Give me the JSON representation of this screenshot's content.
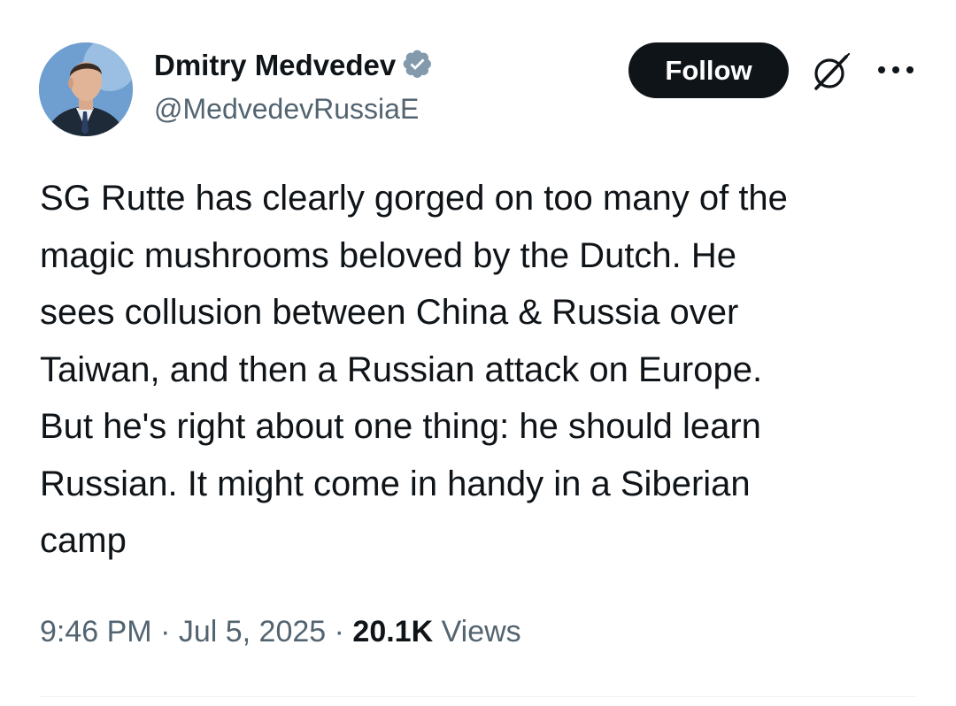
{
  "author": {
    "display_name": "Dmitry Medvedev",
    "handle": "@MedvedevRussiaE",
    "verified": true,
    "avatar_icon": "profile-photo"
  },
  "actions": {
    "follow_label": "Follow",
    "grok_icon": "grok-icon",
    "more_icon": "more-options-icon"
  },
  "tweet": {
    "text": "SG Rutte has clearly gorged on too many of the\nmagic mushrooms beloved by the Dutch. He\nsees collusion between China & Russia over\nTaiwan, and then a Russian attack on Europe.\nBut he's right about one thing: he should learn\nRussian. It might come in handy in a Siberian\ncamp"
  },
  "meta": {
    "time": "9:46 PM",
    "separator": " · ",
    "date": "Jul 5, 2025",
    "views_count": "20.1K",
    "views_label": " Views"
  },
  "colors": {
    "text_primary": "#0f1419",
    "text_secondary": "#536471",
    "verified_blue": "#1d9bf0",
    "verified_gray": "#829aab",
    "button_bg": "#0f1419",
    "divider": "#eff3f4"
  }
}
